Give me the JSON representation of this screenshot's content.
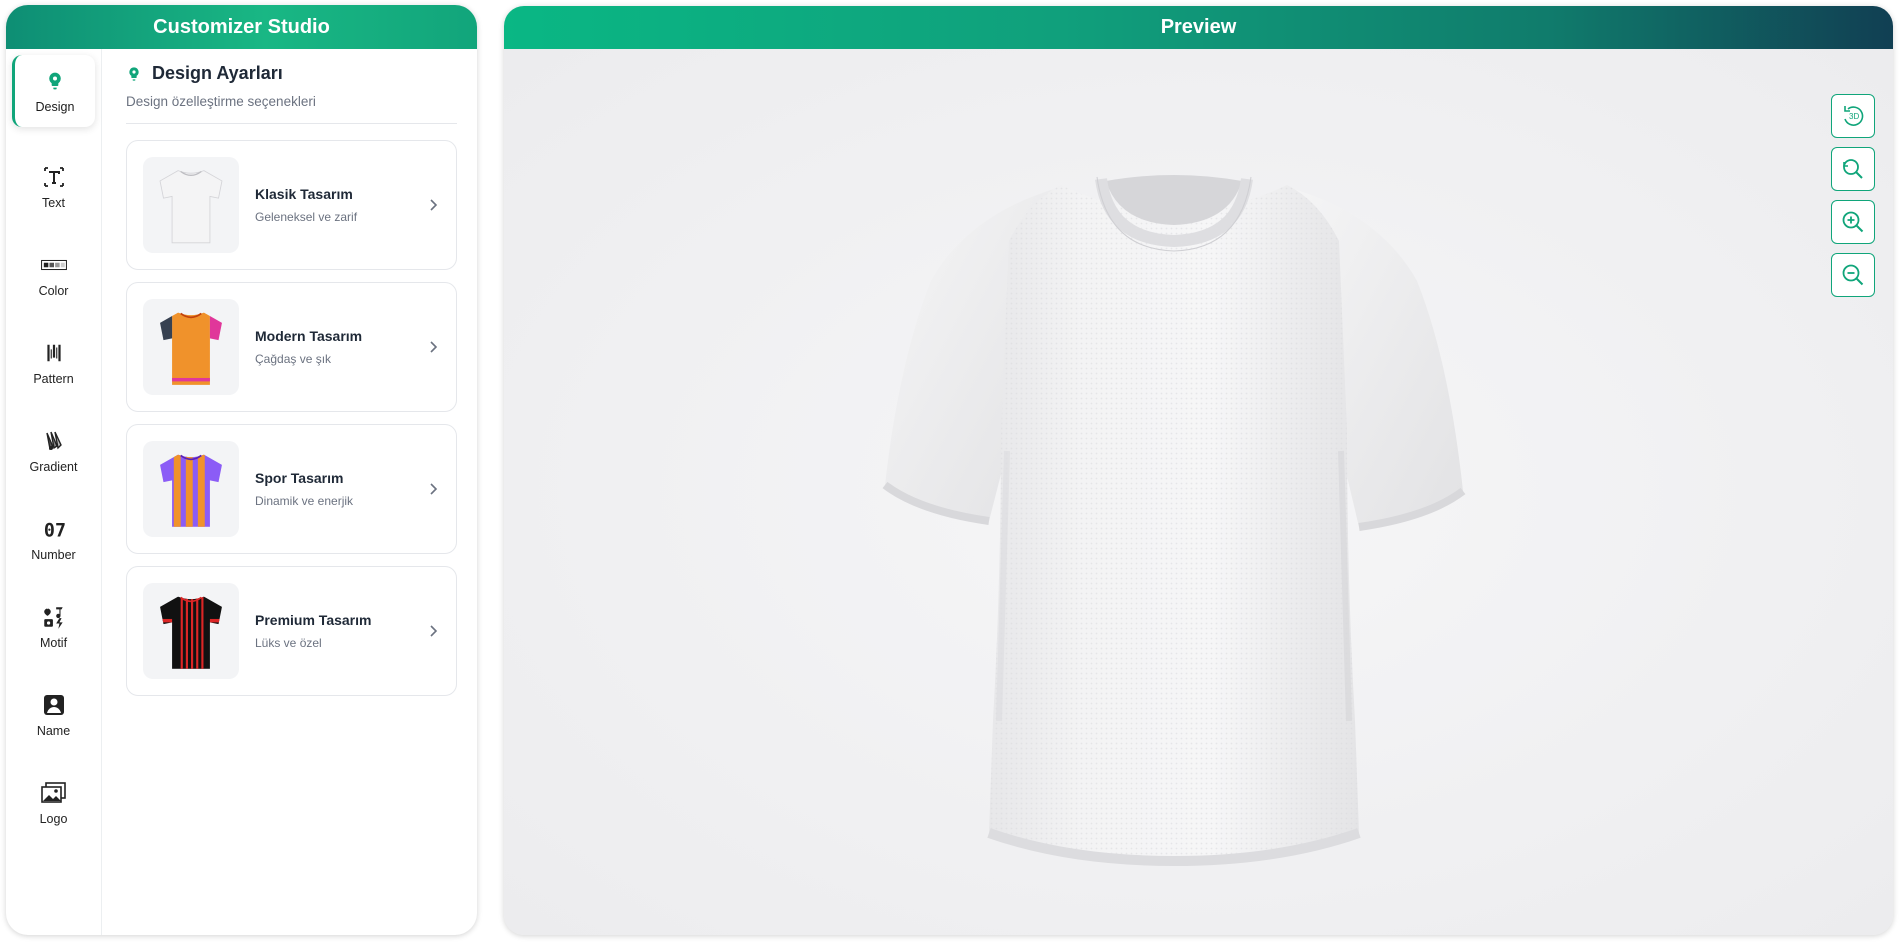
{
  "left_panel": {
    "title": "Customizer Studio"
  },
  "tools": [
    {
      "label": "Design",
      "icon": "lightbulb-icon",
      "active": true
    },
    {
      "label": "Text",
      "icon": "text-icon"
    },
    {
      "label": "Color",
      "icon": "color-swatch-icon"
    },
    {
      "label": "Pattern",
      "icon": "pattern-icon"
    },
    {
      "label": "Gradient",
      "icon": "gradient-icon"
    },
    {
      "label": "Number",
      "icon": "number-icon"
    },
    {
      "label": "Motif",
      "icon": "motif-icon"
    },
    {
      "label": "Name",
      "icon": "name-icon"
    },
    {
      "label": "Logo",
      "icon": "logo-image-icon"
    }
  ],
  "design": {
    "title": "Design Ayarları",
    "subtitle": "Design özelleştirme seçenekleri",
    "options": [
      {
        "title": "Klasik Tasarım",
        "desc": "Geleneksel ve zarif"
      },
      {
        "title": "Modern Tasarım",
        "desc": "Çağdaş ve şık"
      },
      {
        "title": "Spor Tasarım",
        "desc": "Dinamik ve enerjik"
      },
      {
        "title": "Premium Tasarım",
        "desc": "Lüks ve özel"
      }
    ]
  },
  "preview": {
    "title": "Preview",
    "controls": [
      {
        "icon": "rotate-3d-icon",
        "text": "3D"
      },
      {
        "icon": "reset-zoom-icon"
      },
      {
        "icon": "zoom-in-icon"
      },
      {
        "icon": "zoom-out-icon"
      }
    ]
  },
  "colors": {
    "accent": "#10a57a",
    "header_gradient_start": "#0ab784",
    "header_gradient_end": "#113f53",
    "shirt": "#f2f2f3"
  }
}
